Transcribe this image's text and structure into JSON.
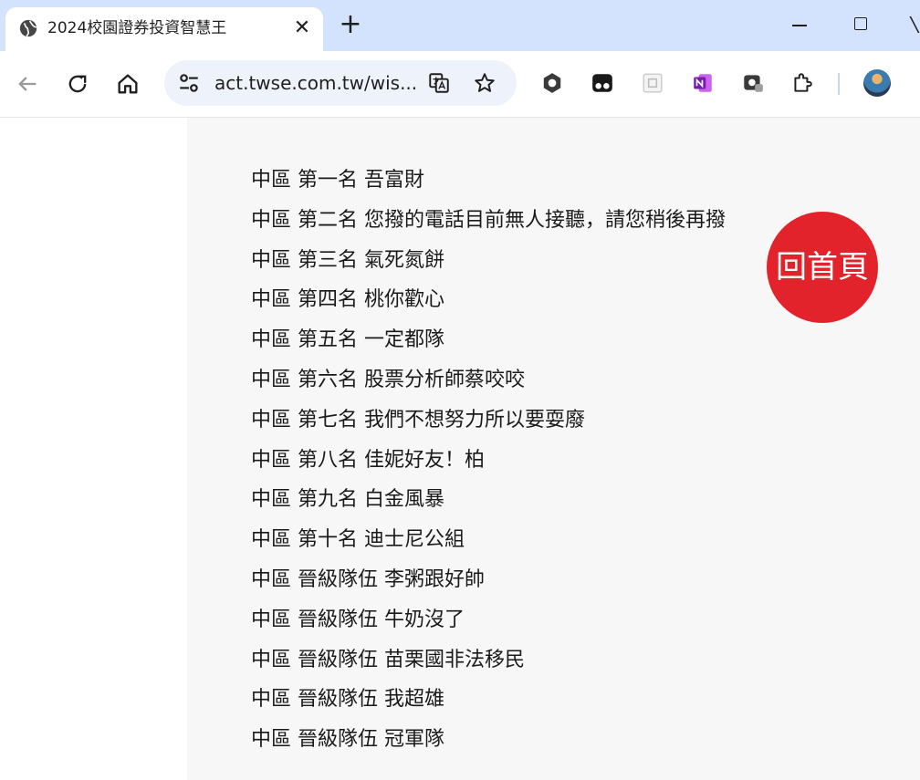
{
  "browser": {
    "tab": {
      "title": "2024校園證券投資智慧王",
      "close_glyph": "✕",
      "favicon": "globe-icon"
    },
    "new_tab_glyph": "+",
    "address": {
      "url": "act.twse.com.tw/wis..."
    },
    "toolbar_icons": [
      "back-arrow-icon",
      "reload-icon",
      "home-icon",
      "site-info-icon",
      "translate-icon",
      "bookmark-star-icon"
    ],
    "extensions": [
      "hexagon-extension-icon",
      "tampermonkey-extension-icon",
      "reader-extension-icon",
      "onenote-extension-icon",
      "screen-capture-extension-icon",
      "puzzle-extensions-icon"
    ],
    "accent": "#d3e3fd"
  },
  "page": {
    "results": [
      "中區 第一名 吾富財",
      "中區 第二名 您撥的電話目前無人接聽，請您稍後再撥",
      "中區 第三名 氣死氮餅",
      "中區 第四名 桃你歡心",
      "中區 第五名 一定都隊",
      "中區 第六名 股票分析師蔡咬咬",
      "中區 第七名 我們不想努力所以要耍廢",
      "中區 第八名 佳妮好友！柏",
      "中區 第九名 白金風暴",
      "中區 第十名 迪士尼公組",
      "中區 晉級隊伍 李粥跟好帥",
      "中區 晉級隊伍 牛奶沒了",
      "中區 晉級隊伍 苗栗國非法移民",
      "中區 晉級隊伍 我超雄",
      "中區 晉級隊伍 冠軍隊"
    ],
    "home_button": {
      "label": "回首頁",
      "color": "#e3232c"
    }
  }
}
